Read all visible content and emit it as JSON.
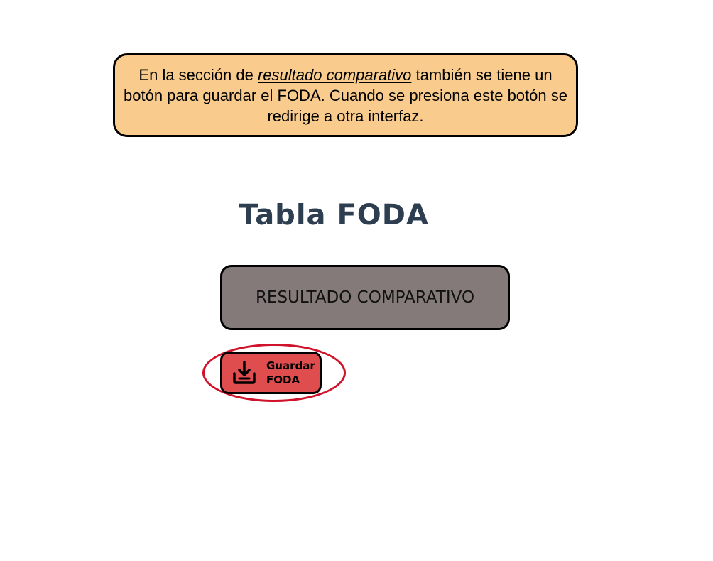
{
  "callout": {
    "text_before": "En la sección de ",
    "emphasis": "resultado comparativo",
    "text_after": " también se tiene un botón para guardar el FODA. Cuando se presiona este botón se redirige a otra interfaz."
  },
  "page": {
    "title_cropped": "Tabla FODA"
  },
  "buttons": {
    "result_label": "RESULTADO COMPARATIVO",
    "save_line1": "Guardar",
    "save_line2": "FODA"
  },
  "icons": {
    "save": "download-tray-icon"
  },
  "colors": {
    "callout_bg": "#f9cc8e",
    "result_bg": "#857a7a",
    "save_bg": "#df4d4f",
    "highlight": "#d0122b",
    "title": "#2c3e50"
  }
}
